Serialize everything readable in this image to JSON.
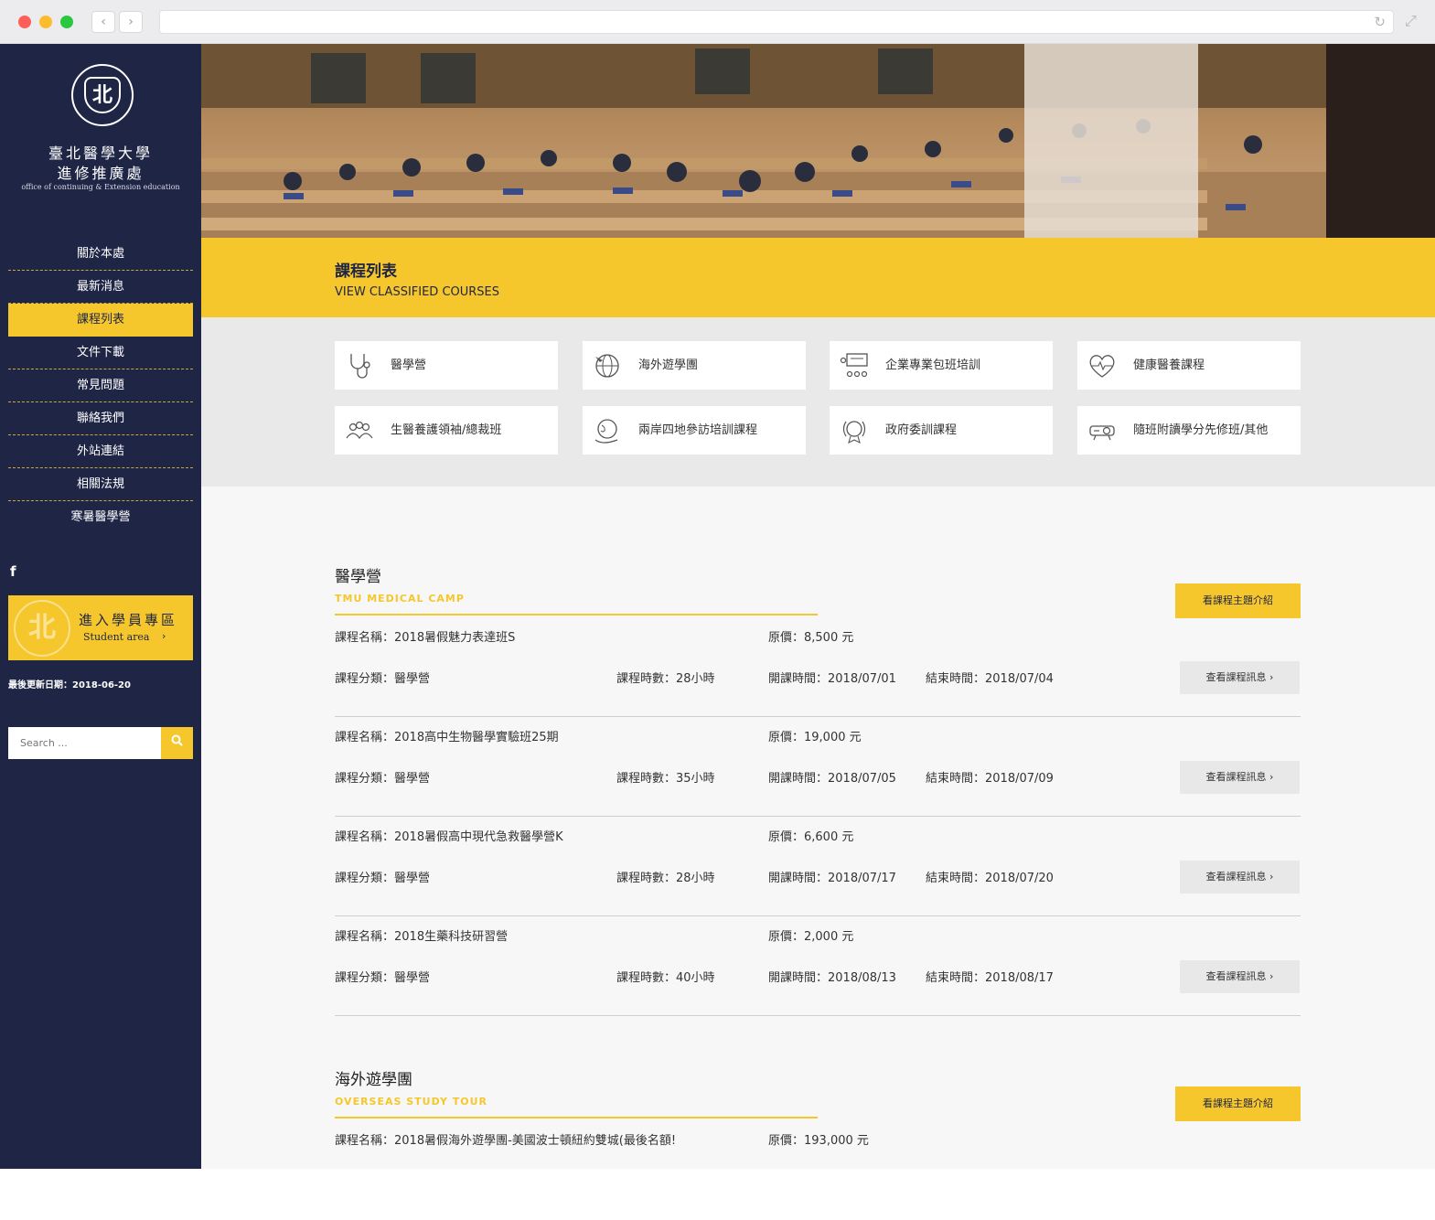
{
  "sidebar": {
    "logo": {
      "seal_text": "北",
      "name_line1": "臺北醫學大學",
      "name_line2": "進修推廣處",
      "english": "office of continuing & Extension education"
    },
    "menu": [
      "關於本處",
      "最新消息",
      "課程列表",
      "文件下載",
      "常見問題",
      "聯絡我們",
      "外站連結",
      "相關法規",
      "寒暑醫學營"
    ],
    "active_item": "課程列表",
    "student_area": {
      "title": "進入學員專區",
      "subtitle": "Student area",
      "arrow": "›"
    },
    "last_updated": "最後更新日期：2018-06-20",
    "search_placeholder": "Search ..."
  },
  "banner": {
    "title": "課程列表",
    "subtitle": "VIEW CLASSIFIED COURSES"
  },
  "categories": [
    {
      "label": "醫學營",
      "icon": "stethoscope-icon"
    },
    {
      "label": "海外遊學團",
      "icon": "globe-plane-icon"
    },
    {
      "label": "企業專業包班培訓",
      "icon": "presentation-group-icon"
    },
    {
      "label": "健康醫養課程",
      "icon": "heart-pulse-icon"
    },
    {
      "label": "生醫養護領袖/總裁班",
      "icon": "people-group-icon"
    },
    {
      "label": "兩岸四地參訪培訓課程",
      "icon": "globe-hand-icon"
    },
    {
      "label": "政府委訓課程",
      "icon": "award-badge-icon"
    },
    {
      "label": "隨班附讀學分先修班/其他",
      "icon": "projector-icon"
    }
  ],
  "sections": [
    {
      "title": "醫學營",
      "subtitle": "TMU MEDICAL CAMP",
      "theme_button": "看課程主題介紹",
      "courses": [
        {
          "name": "課程名稱：2018暑假魅力表達班S",
          "price": "原價：8,500 元",
          "category": "課程分類：醫學營",
          "hours": "課程時數：28小時",
          "start": "開課時間：2018/07/01",
          "end": "結束時間：2018/07/04",
          "button": "查看課程訊息 ›"
        },
        {
          "name": "課程名稱：2018高中生物醫學實驗班25期",
          "price": "原價：19,000 元",
          "category": "課程分類：醫學營",
          "hours": "課程時數：35小時",
          "start": "開課時間：2018/07/05",
          "end": "結束時間：2018/07/09",
          "button": "查看課程訊息 ›"
        },
        {
          "name": "課程名稱：2018暑假高中現代急救醫學營K",
          "price": "原價：6,600 元",
          "category": "課程分類：醫學營",
          "hours": "課程時數：28小時",
          "start": "開課時間：2018/07/17",
          "end": "結束時間：2018/07/20",
          "button": "查看課程訊息 ›"
        },
        {
          "name": "課程名稱：2018生藥科技研習營",
          "price": "原價：2,000 元",
          "category": "課程分類：醫學營",
          "hours": "課程時數：40小時",
          "start": "開課時間：2018/08/13",
          "end": "結束時間：2018/08/17",
          "button": "查看課程訊息 ›"
        }
      ]
    },
    {
      "title": "海外遊學團",
      "subtitle": "OVERSEAS STUDY TOUR",
      "theme_button": "看課程主題介紹",
      "courses": [
        {
          "name": "課程名稱：2018暑假海外遊學團-美國波士頓紐約雙城(最後名額!",
          "price": "原價：193,000 元"
        }
      ]
    }
  ],
  "colors": {
    "navy": "#1f2545",
    "accent": "#f6c72c",
    "category_band": "#e9e9ea"
  }
}
